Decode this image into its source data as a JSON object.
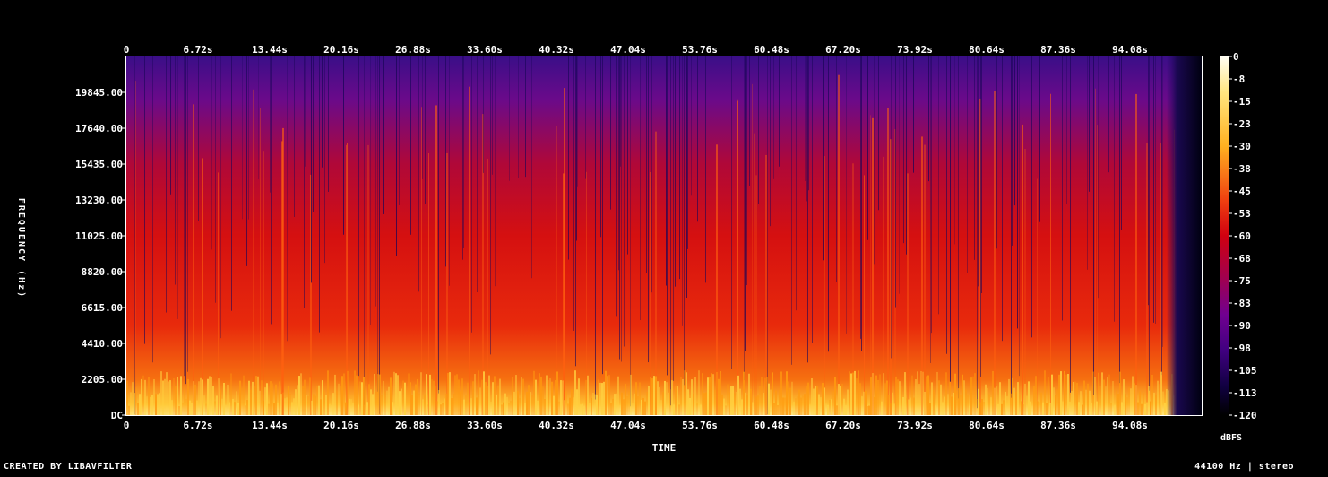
{
  "footer": {
    "left": "CREATED BY LIBAVFILTER",
    "right": "44100 Hz | stereo"
  },
  "chart_data": {
    "type": "heatmap",
    "title": "",
    "xlabel": "TIME",
    "ylabel": "FREQUENCY (Hz)",
    "x_ticks": [
      "0",
      "6.72s",
      "13.44s",
      "20.16s",
      "26.88s",
      "33.60s",
      "40.32s",
      "47.04s",
      "53.76s",
      "60.48s",
      "67.20s",
      "73.92s",
      "80.64s",
      "87.36s",
      "94.08s"
    ],
    "x_tick_values": [
      0,
      6.72,
      13.44,
      20.16,
      26.88,
      33.6,
      40.32,
      47.04,
      53.76,
      60.48,
      67.2,
      73.92,
      80.64,
      87.36,
      94.08
    ],
    "xlim": [
      0,
      100.8
    ],
    "y_ticks": [
      "DC",
      "2205.00",
      "4410.00",
      "6615.00",
      "8820.00",
      "11025.00",
      "13230.00",
      "15435.00",
      "17640.00",
      "19845.00"
    ],
    "y_tick_values": [
      0,
      2205,
      4410,
      6615,
      8820,
      11025,
      13230,
      15435,
      17640,
      19845
    ],
    "ylim": [
      0,
      22050
    ],
    "colorbar": {
      "label": "dBFS",
      "ticks": [
        "0",
        "-8",
        "-15",
        "-23",
        "-30",
        "-38",
        "-45",
        "-53",
        "-60",
        "-68",
        "-75",
        "-83",
        "-90",
        "-98",
        "-105",
        "-113",
        "-120"
      ],
      "range": [
        -120,
        0
      ]
    },
    "signal_end_time": 98.5,
    "colors": {
      "background": "#000000",
      "silence": "#000010",
      "low": "#2a0a6e",
      "mid": "#d01010",
      "high": "#ff9a10",
      "peak": "#fffde0"
    }
  }
}
